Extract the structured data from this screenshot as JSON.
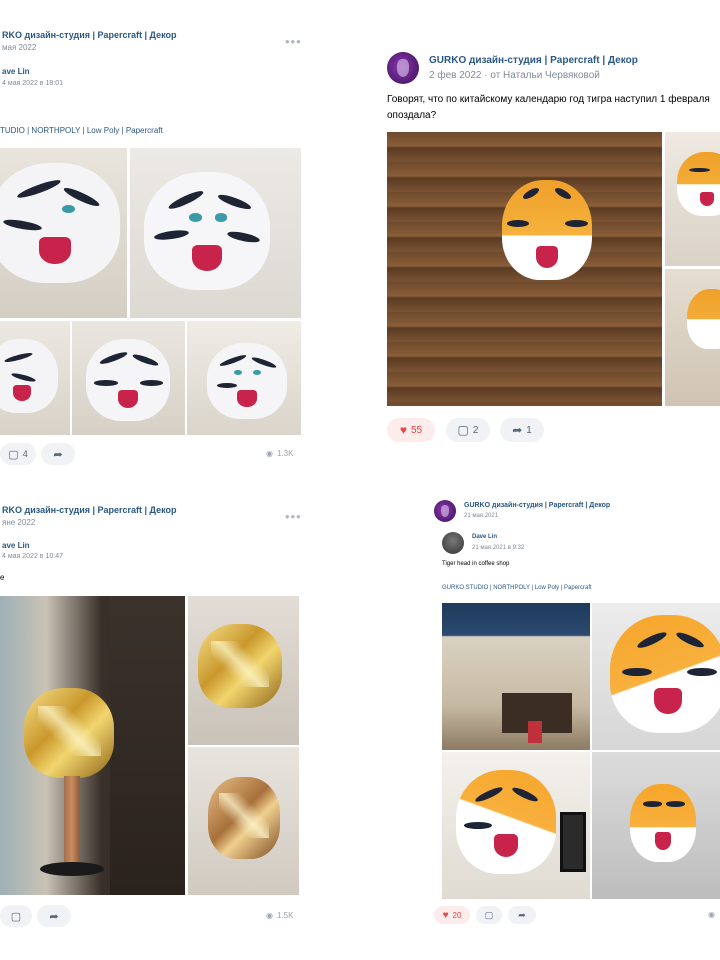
{
  "posts": [
    {
      "group": "RKO дизайн-студия | Papercraft | Декор",
      "date": "мая 2022",
      "author": "ave Lin",
      "author_date": "4 мая 2022 в 18:01",
      "hashtags": "TUDIO | NORTHPOLY | Low Poly | Papercraft",
      "comments": "4",
      "views": "1.3K"
    },
    {
      "group": "GURKO дизайн-студия | Papercraft | Декор",
      "date": "2 фев 2022 · от Натальи Червяковой",
      "text_line1": "Говорят, что по китайскому календарю год тигра наступил 1 февраля",
      "text_line2": "опоздала?",
      "likes": "55",
      "comments": "2",
      "shares": "1"
    },
    {
      "group": "RKO дизайн-студия | Papercraft | Декор",
      "date": "яне 2022",
      "author": "ave Lin",
      "author_date": "4 мая 2022 в 10:47",
      "text": "e",
      "views": "1.5K"
    },
    {
      "group": "GURKO дизайн-студия | Papercraft | Декор",
      "date": "21 мая 2021",
      "author": "Dave Lin",
      "author_date": "21 мая 2021 в 9:32",
      "text": "Tiger head in coffee shop",
      "hashtags": "GURKO STUDIO | NORTHPOLY | Low Poly | Papercraft",
      "likes": "20"
    }
  ],
  "icons": {
    "more": "more-dots-icon",
    "like": "heart-icon",
    "comment": "comment-icon",
    "share": "share-arrow-icon",
    "views": "eye-icon"
  },
  "colors": {
    "link": "#2a5885",
    "muted": "#818c99",
    "like_active": "#e64646",
    "button_bg": "#f0f2f5"
  }
}
